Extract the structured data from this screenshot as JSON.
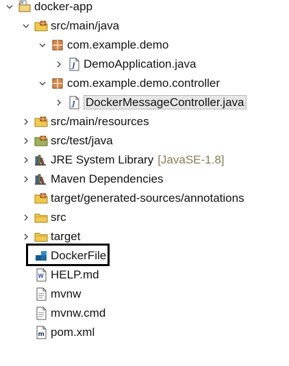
{
  "tree": {
    "rows": [
      {
        "label": "docker-app",
        "icon": "maven-project-icon",
        "chevron": "expanded",
        "decor": ""
      },
      {
        "label": "src/main/java",
        "icon": "source-folder-icon",
        "chevron": "expanded",
        "decor": ""
      },
      {
        "label": "com.example.demo",
        "icon": "package-icon",
        "chevron": "expanded",
        "decor": ""
      },
      {
        "label": "DemoApplication.java",
        "icon": "java-file-icon",
        "chevron": "collapsed",
        "decor": ""
      },
      {
        "label": "com.example.demo.controller",
        "icon": "package-icon",
        "chevron": "expanded",
        "decor": ""
      },
      {
        "label": "DockerMessageController.java",
        "icon": "java-file-icon",
        "chevron": "collapsed",
        "decor": "",
        "selected": true
      },
      {
        "label": "src/main/resources",
        "icon": "source-folder-icon",
        "chevron": "collapsed",
        "decor": ""
      },
      {
        "label": "src/test/java",
        "icon": "test-source-folder-icon",
        "chevron": "collapsed",
        "decor": ""
      },
      {
        "label": "JRE System Library",
        "icon": "library-icon",
        "chevron": "collapsed",
        "decor": "[JavaSE-1.8]"
      },
      {
        "label": "Maven Dependencies",
        "icon": "library-icon",
        "chevron": "collapsed",
        "decor": ""
      },
      {
        "label": "target/generated-sources/annotations",
        "icon": "generated-source-folder-icon",
        "chevron": "none",
        "decor": ""
      },
      {
        "label": "src",
        "icon": "folder-icon",
        "chevron": "collapsed",
        "decor": ""
      },
      {
        "label": "target",
        "icon": "folder-icon",
        "chevron": "collapsed",
        "decor": ""
      },
      {
        "label": "DockerFile",
        "icon": "docker-file-icon",
        "chevron": "none",
        "decor": "",
        "highlighted": true
      },
      {
        "label": "HELP.md",
        "icon": "markdown-file-icon",
        "chevron": "none",
        "decor": ""
      },
      {
        "label": "mvnw",
        "icon": "text-file-icon",
        "chevron": "none",
        "decor": ""
      },
      {
        "label": "mvnw.cmd",
        "icon": "text-file-icon",
        "chevron": "none",
        "decor": ""
      },
      {
        "label": "pom.xml",
        "icon": "pom-file-icon",
        "chevron": "none",
        "decor": ""
      }
    ]
  },
  "colors": {
    "highlight_box": "#000000",
    "selection_bg": "#e6e6e6",
    "decor_text": "#8a7b4f",
    "package_icon": "#b5651d",
    "folder_icon": "#e8c14a",
    "java_file_icon": "#2d5fa8"
  }
}
